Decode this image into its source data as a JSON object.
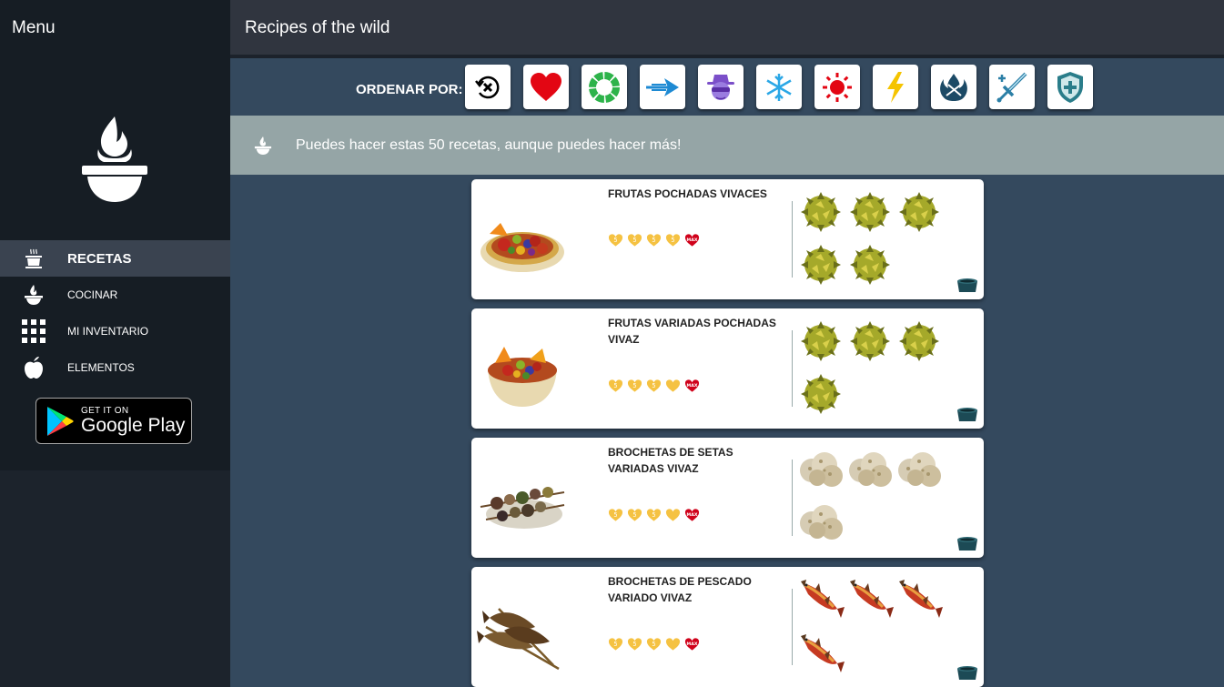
{
  "sidebar": {
    "menu_title": "Menu",
    "logo_icon": "cooking-pot-flame-icon",
    "nav": [
      {
        "label": "RECETAS",
        "icon": "pot-icon",
        "active": true
      },
      {
        "label": "COCINAR",
        "icon": "flame-bowl-icon",
        "active": false
      },
      {
        "label": "MI INVENTARIO",
        "icon": "grid-icon",
        "active": false
      },
      {
        "label": "ELEMENTOS",
        "icon": "apple-icon",
        "active": false
      }
    ],
    "store_badge": {
      "small": "GET IT ON",
      "big": "Google Play"
    }
  },
  "header": {
    "title": "Recipes of the wild"
  },
  "sortbar": {
    "label": "ORDENAR POR:",
    "buttons": [
      {
        "name": "reset",
        "icon": "reset-x-icon"
      },
      {
        "name": "hearts",
        "icon": "heart-icon"
      },
      {
        "name": "stamina",
        "icon": "stamina-wheel-icon"
      },
      {
        "name": "speed",
        "icon": "speed-arrow-icon"
      },
      {
        "name": "stealth",
        "icon": "stealth-mask-icon"
      },
      {
        "name": "cold-resistance",
        "icon": "snowflake-icon"
      },
      {
        "name": "heat-resistance",
        "icon": "sun-icon"
      },
      {
        "name": "shock-resistance",
        "icon": "lightning-icon"
      },
      {
        "name": "flame-guard",
        "icon": "flame-guard-icon"
      },
      {
        "name": "attack",
        "icon": "sword-icon"
      },
      {
        "name": "defense",
        "icon": "shield-icon"
      }
    ]
  },
  "banner": {
    "text": "Puedes hacer estas 50 recetas, aunque puedes hacer más!"
  },
  "colors": {
    "sidebar": "#1c232c",
    "header": "#30353f",
    "main": "#34495e",
    "banner": "#95a5a6",
    "heart_gold": "#f5c242",
    "heart_red": "#d0021b"
  },
  "recipes": [
    {
      "name": "FRUTAS POCHADAS VIVACES",
      "dish": "fruit-bowl",
      "hearts": [
        "gold-5",
        "gold-5",
        "gold-5",
        "gold-5",
        "max"
      ],
      "ingredient": "durian",
      "ingredient_count": 5
    },
    {
      "name": "FRUTAS VARIADAS POCHADAS VIVAZ",
      "dish": "fruit-bowl-2",
      "hearts": [
        "gold-5",
        "gold-5",
        "gold-5",
        "gold",
        "max"
      ],
      "ingredient": "durian",
      "ingredient_count": 4
    },
    {
      "name": "BROCHETAS DE SETAS VARIADAS VIVAZ",
      "dish": "skewers",
      "hearts": [
        "gold-5",
        "gold-5",
        "gold-5",
        "gold",
        "max"
      ],
      "ingredient": "truffle",
      "ingredient_count": 4
    },
    {
      "name": "BROCHETAS DE PESCADO VARIADO VIVAZ",
      "dish": "fish-skewers",
      "hearts": [
        "gold-5",
        "gold-5",
        "gold-5",
        "gold",
        "max"
      ],
      "ingredient": "fish",
      "ingredient_count": 4
    }
  ]
}
